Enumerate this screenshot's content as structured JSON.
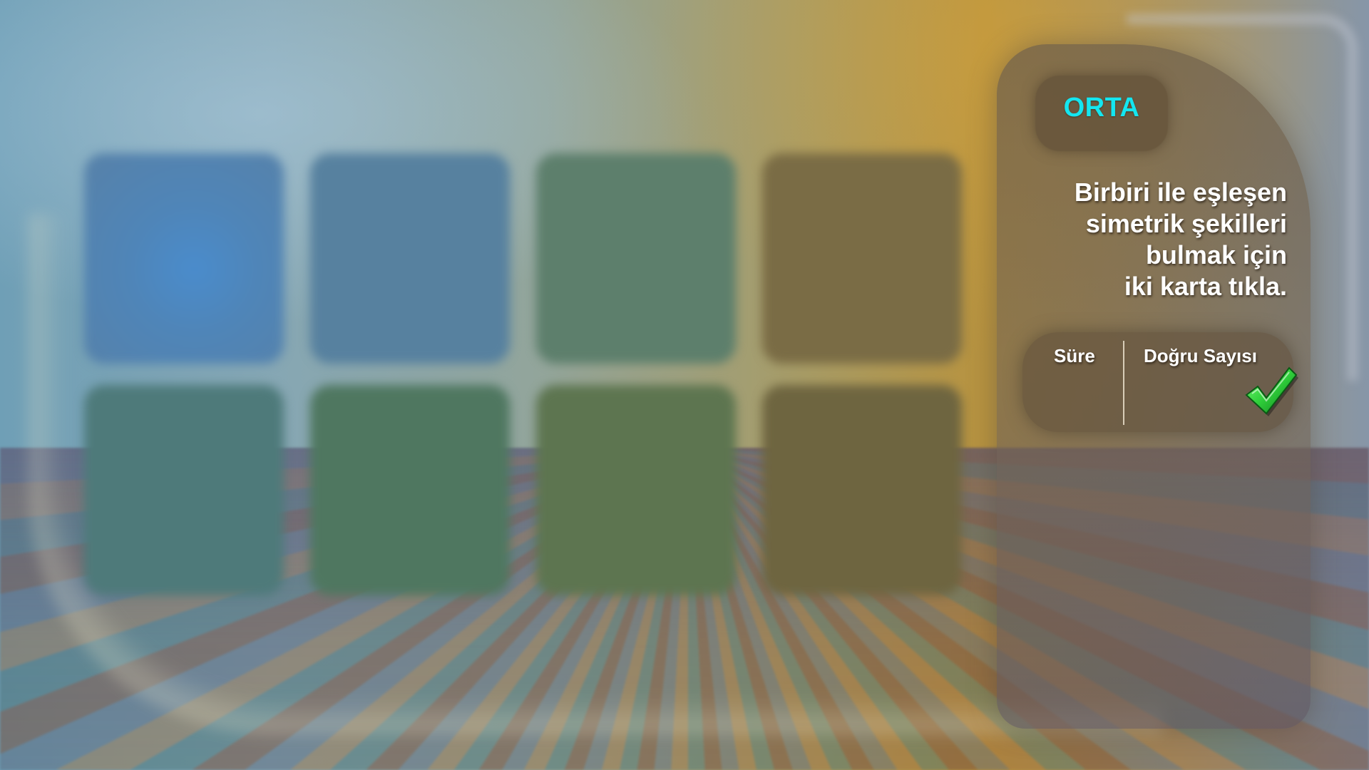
{
  "game": {
    "level_label": "ORTA",
    "instructions": {
      "line1": "Birbiri ile eşleşen",
      "line2": "simetrik şekilleri",
      "line3": "bulmak için",
      "line4": "iki karta tıkla."
    },
    "stats": {
      "time_label": "Süre",
      "correct_label": "Doğru Sayısı",
      "correct_icon": "checkmark-icon"
    },
    "board": {
      "rows": 2,
      "columns": 4,
      "card_count": 8
    }
  },
  "colors": {
    "level_text": "#14e6f0",
    "label_text": "#ffffff",
    "check_green": "#2fcf3a"
  }
}
